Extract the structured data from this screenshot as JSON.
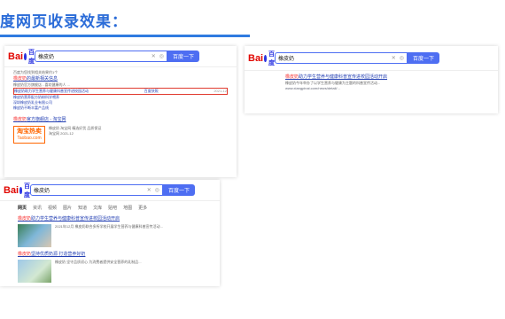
{
  "heading": "度网页收录效果：",
  "colors": {
    "accent": "#2f7be0",
    "baidu_blue": "#4e6ef2",
    "baidu_red": "#e10601",
    "highlight_red": "#f73131"
  },
  "logo": {
    "bai": "Bai",
    "du": "百度"
  },
  "shot_a": {
    "query": "橡皮奶",
    "search_button": "百度一下",
    "line1": "百度为您找到相关结果约1个",
    "r1_title_em": "橡皮奶",
    "r1_title_rest": "的最新相关信息",
    "r1_sub": "橡皮奶官方旗舰店 - 喜欢健康的人 ...",
    "r1_link": "橡皮奶助力学生营养与健康科普宣传进校园活动",
    "r1_badge": "百度快照",
    "r1_date": "2021-12",
    "r2_link": "橡皮奶营养配方奶粉科学喂养",
    "r3_link": "深圳橡皮奶乳业有限公司",
    "r4_link": "橡皮奶不断丰富产品线",
    "r5_title_em": "橡皮奶",
    "r5_title_rest": "官方旗舰店 - 淘宝网",
    "taobao_t1": "淘宝热卖",
    "taobao_t2": "Taobao.com",
    "r5_desc": "橡皮奶 淘宝网 精选好货 品质保证",
    "r5_date": "淘宝网 2021-12"
  },
  "shot_b": {
    "query": "橡皮奶",
    "search_button": "百度一下",
    "r_title_em": "橡皮奶",
    "r_title_rest": "助力学生营养与健康科普宣传进校园活动开启",
    "r_desc": "橡皮奶今年举办了以学生营养与健康为主题的科普宣传活动...",
    "r_url": "www.xiangpinai.com/news/detail/..."
  },
  "shot_c": {
    "query": "橡皮奶",
    "search_button": "百度一下",
    "tabs": [
      "网页",
      "资讯",
      "视频",
      "图片",
      "知道",
      "文库",
      "贴吧",
      "地图",
      "更多"
    ],
    "c1_title_em": "橡皮奶",
    "c1_title_rest": "助力学生营养与健康科普宣传进校园活动开启",
    "c1_desc": "2021年12月 橡皮奶联合多所学校开展学生营养与健康科普宣传活动...",
    "c2_title_em": "橡皮奶",
    "c2_title_rest": "坚持优质奶源 打造营养好奶",
    "c2_desc": "橡皮奶 坚守品质初心 为消费者提供安全营养的乳制品..."
  }
}
